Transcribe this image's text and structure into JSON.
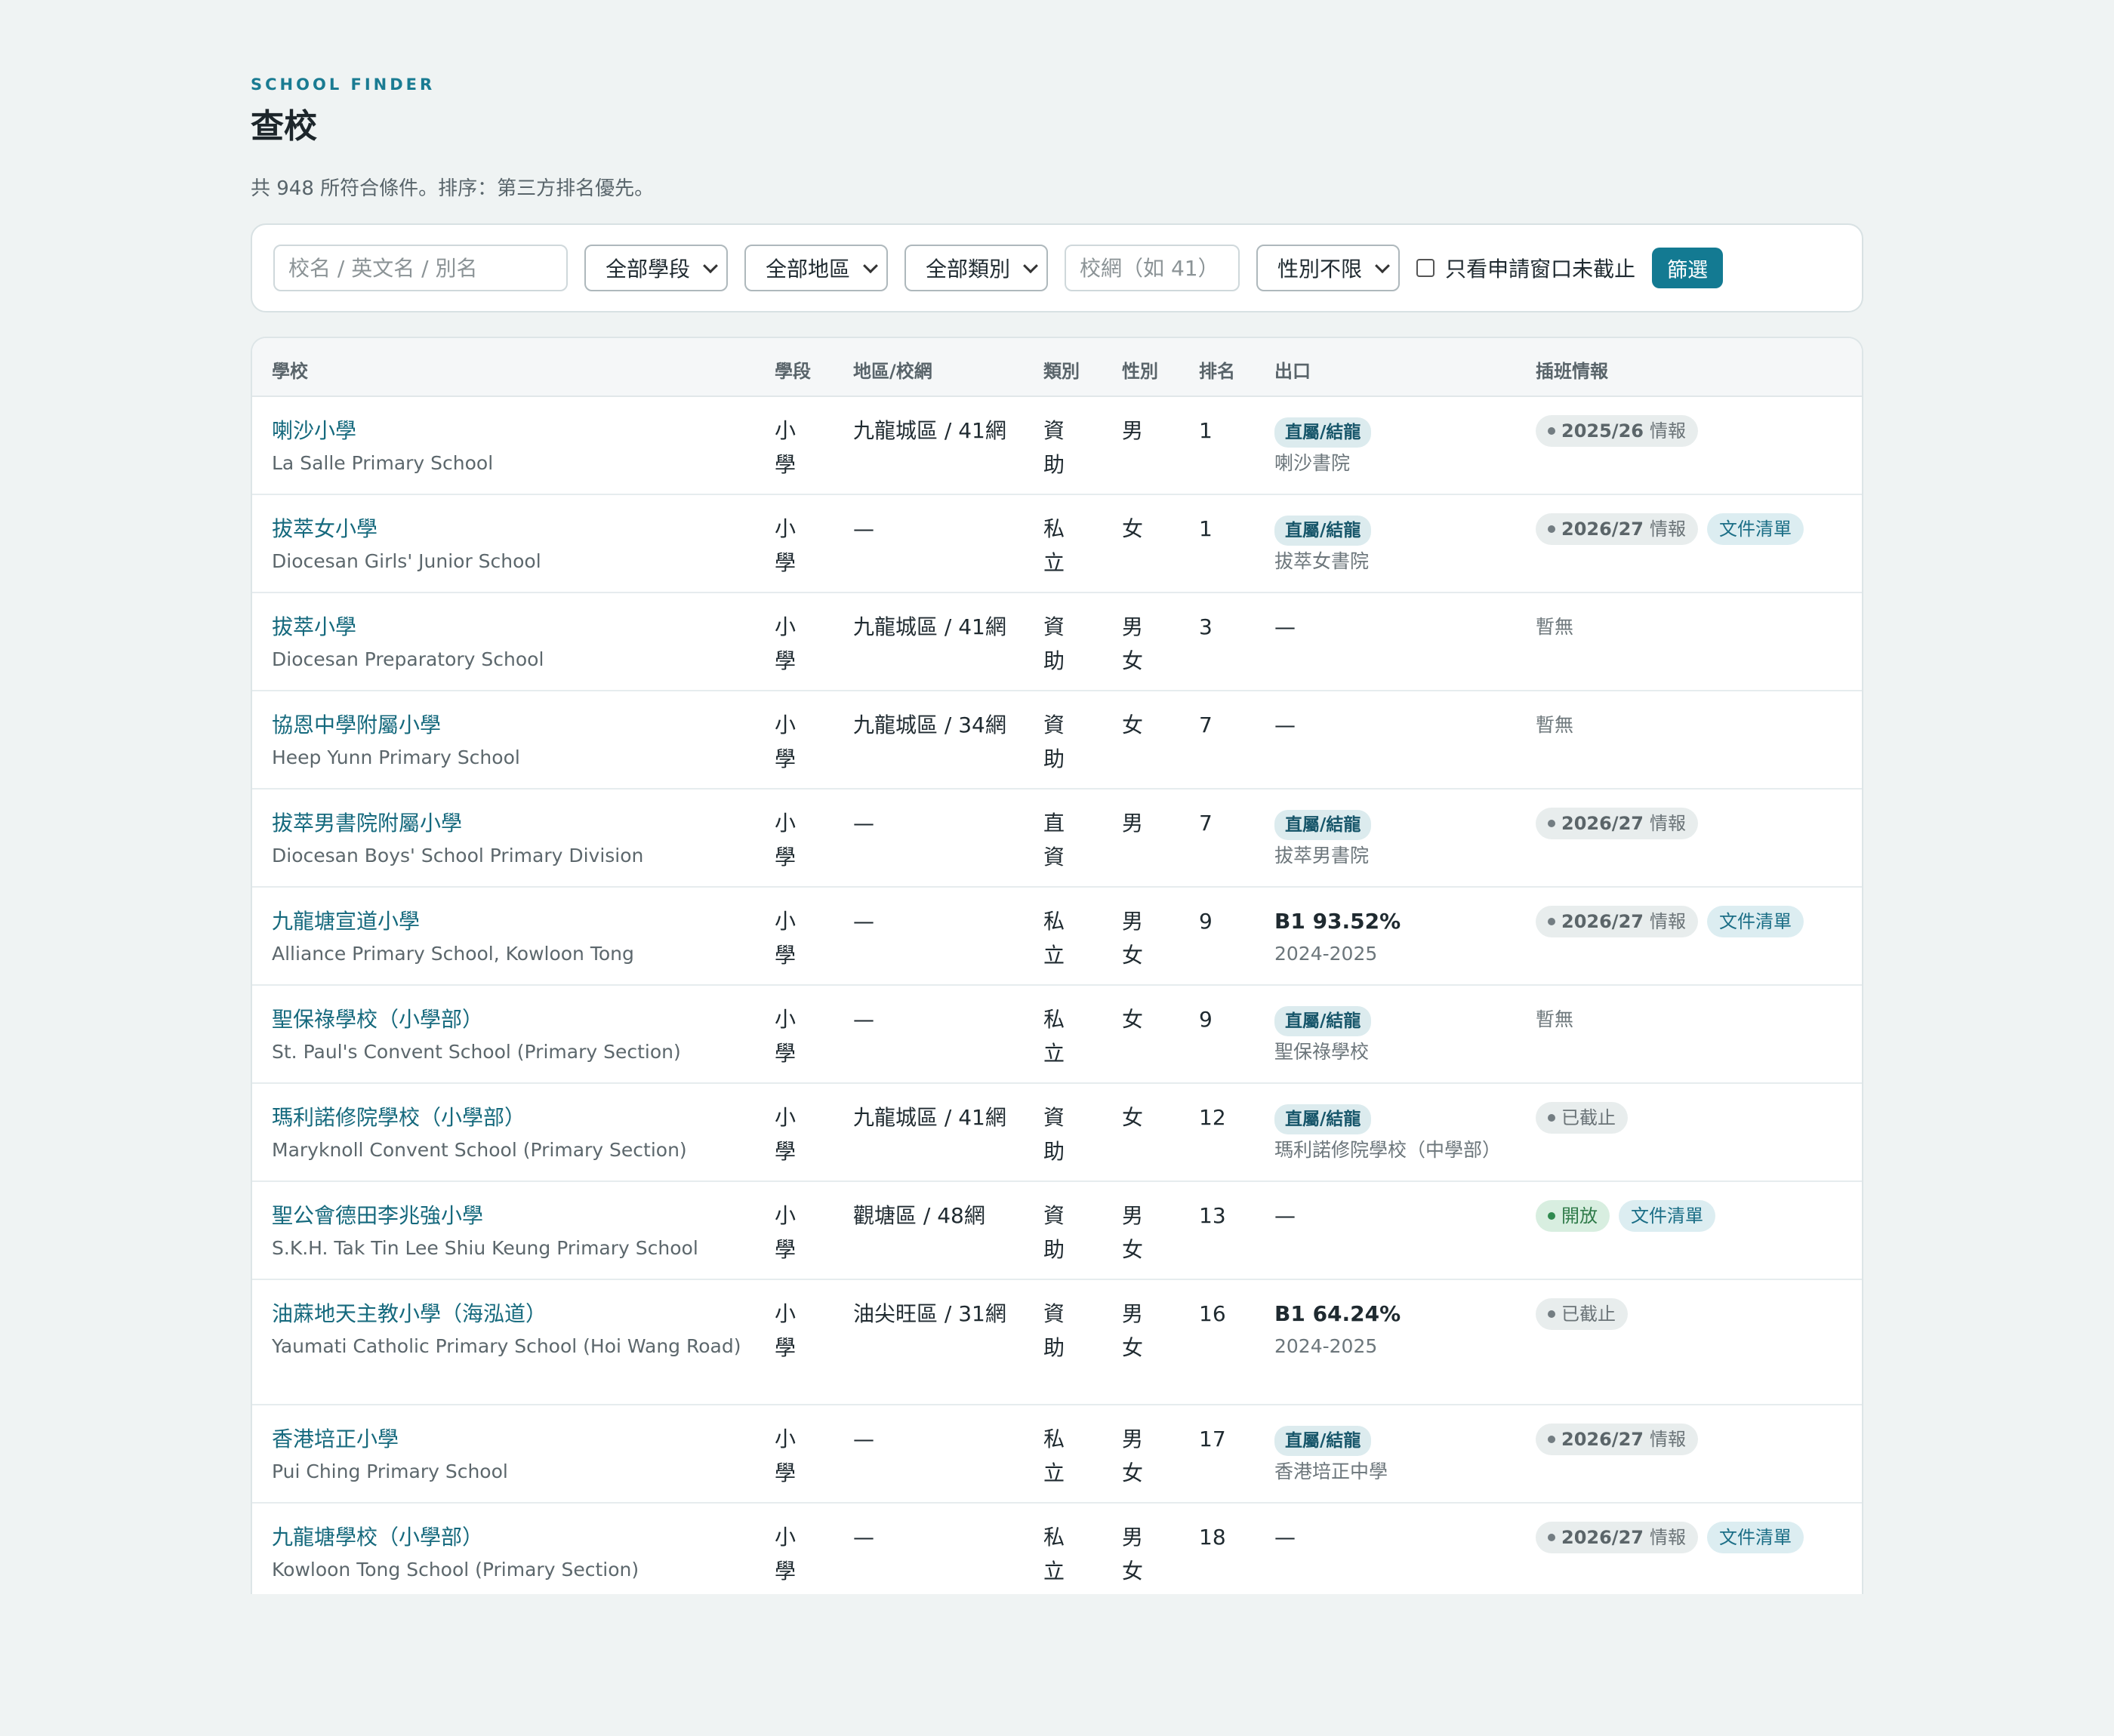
{
  "header": {
    "eyebrow": "SCHOOL FINDER",
    "title": "查校",
    "summary": "共 948 所符合條件。排序：第三方排名優先。"
  },
  "filters": {
    "search_placeholder": "校名 / 英文名 / 別名",
    "stage": "全部學段",
    "district": "全部地區",
    "category": "全部類別",
    "net_placeholder": "校網（如 41）",
    "gender": "性別不限",
    "open_only_label": "只看申請窗口未截止",
    "open_only_checked": false,
    "submit": "篩選"
  },
  "columns": {
    "school": "學校",
    "stage": "學段",
    "district": "地區/校網",
    "type": "類別",
    "gender": "性別",
    "rank": "排名",
    "outlet": "出口",
    "info": "插班情報"
  },
  "rows": [
    {
      "name": "喇沙小學",
      "ename": "La Salle Primary School",
      "stage": "小學",
      "district": "九龍城區 / 41網",
      "type": "資助",
      "gender": "男",
      "rank": "1",
      "outlet_tag": "直屬/結龍",
      "outlet_sub": "喇沙書院",
      "info_year": "2025/26",
      "info_word": "情報"
    },
    {
      "name": "拔萃女小學",
      "ename": "Diocesan Girls' Junior School",
      "stage": "小學",
      "district": "—",
      "type": "私立",
      "gender": "女",
      "rank": "1",
      "outlet_tag": "直屬/結龍",
      "outlet_sub": "拔萃女書院",
      "info_year": "2026/27",
      "info_word": "情報",
      "doc": "文件清單"
    },
    {
      "name": "拔萃小學",
      "ename": "Diocesan Preparatory School",
      "stage": "小學",
      "district": "九龍城區 / 41網",
      "type": "資助",
      "gender": "男女",
      "rank": "3",
      "outlet_dash": "—",
      "info_none": "暫無"
    },
    {
      "name": "協恩中學附屬小學",
      "ename": "Heep Yunn Primary School",
      "stage": "小學",
      "district": "九龍城區 / 34網",
      "type": "資助",
      "gender": "女",
      "rank": "7",
      "outlet_dash": "—",
      "info_none": "暫無"
    },
    {
      "name": "拔萃男書院附屬小學",
      "ename": "Diocesan Boys' School Primary Division",
      "stage": "小學",
      "district": "—",
      "type": "直資",
      "gender": "男",
      "rank": "7",
      "outlet_tag": "直屬/結龍",
      "outlet_sub": "拔萃男書院",
      "info_year": "2026/27",
      "info_word": "情報"
    },
    {
      "name": "九龍塘宣道小學",
      "ename": "Alliance Primary School, Kowloon Tong",
      "stage": "小學",
      "district": "—",
      "type": "私立",
      "gender": "男女",
      "rank": "9",
      "outlet_pct": "B1 93.52%",
      "outlet_sub": "2024-2025",
      "info_year": "2026/27",
      "info_word": "情報",
      "doc": "文件清單"
    },
    {
      "name": "聖保祿學校（小學部）",
      "ename": "St. Paul's Convent School (Primary Section)",
      "stage": "小學",
      "district": "—",
      "type": "私立",
      "gender": "女",
      "rank": "9",
      "outlet_tag": "直屬/結龍",
      "outlet_sub": "聖保祿學校",
      "info_none": "暫無"
    },
    {
      "name": "瑪利諾修院學校（小學部）",
      "ename": "Maryknoll Convent School (Primary Section)",
      "stage": "小學",
      "district": "九龍城區 / 41網",
      "type": "資助",
      "gender": "女",
      "rank": "12",
      "outlet_tag": "直屬/結龍",
      "outlet_sub": "瑪利諾修院學校（中學部）",
      "info_status": "已截止"
    },
    {
      "name": "聖公會德田李兆強小學",
      "ename": "S.K.H. Tak Tin Lee Shiu Keung Primary School",
      "stage": "小學",
      "district": "觀塘區 / 48網",
      "type": "資助",
      "gender": "男女",
      "rank": "13",
      "outlet_dash": "—",
      "info_open": "開放",
      "doc": "文件清單"
    },
    {
      "name": "油蔴地天主教小學（海泓道）",
      "ename": "Yaumati Catholic Primary School (Hoi Wang Road)",
      "stage": "小學",
      "district": "油尖旺區 / 31網",
      "type": "資助",
      "gender": "男女",
      "rank": "16",
      "outlet_pct": "B1 64.24%",
      "outlet_sub": "2024-2025",
      "info_status": "已截止"
    },
    {
      "name": "香港培正小學",
      "ename": "Pui Ching Primary School",
      "stage": "小學",
      "district": "—",
      "type": "私立",
      "gender": "男女",
      "rank": "17",
      "outlet_tag": "直屬/結龍",
      "outlet_sub": "香港培正中學",
      "info_year": "2026/27",
      "info_word": "情報"
    },
    {
      "name": "九龍塘學校（小學部）",
      "ename": "Kowloon Tong School (Primary Section)",
      "stage": "小學",
      "district": "—",
      "type": "私立",
      "gender": "男女",
      "rank": "18",
      "outlet_dash": "—",
      "info_year": "2026/27",
      "info_word": "情報",
      "doc": "文件清單"
    }
  ]
}
